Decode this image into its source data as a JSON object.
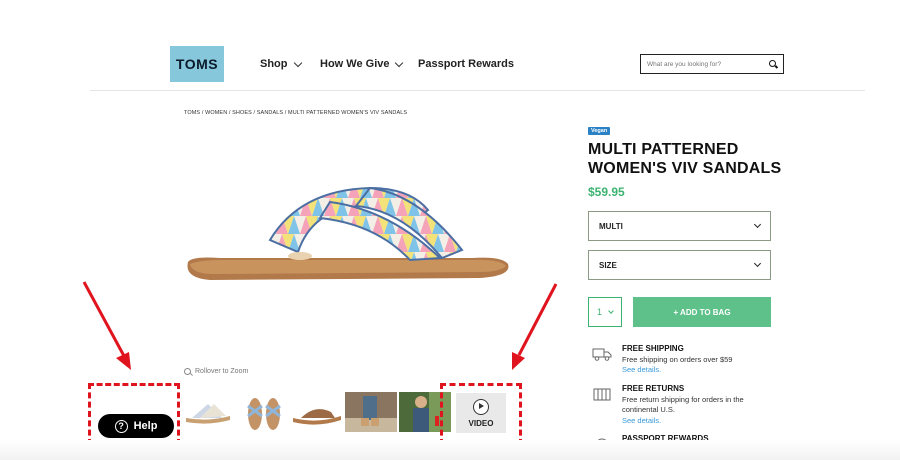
{
  "header": {
    "logo_text": "TOMS",
    "nav": [
      "Shop",
      "How We Give",
      "Passport Rewards"
    ],
    "search_placeholder": "What are you looking for?"
  },
  "breadcrumb": "TOMS / WOMEN / SHOES / SANDALS / MULTI PATTERNED WOMEN'S VIV SANDALS",
  "product": {
    "badge": "Vegan",
    "title": "MULTI PATTERNED WOMEN'S VIV SANDALS",
    "price": "$59.95",
    "color_select": "MULTI",
    "size_select": "SIZE",
    "quantity": "1",
    "add_to_bag": "+ ADD TO BAG",
    "zoom_hint": "Rollover to Zoom",
    "video_label": "VIDEO"
  },
  "info": [
    {
      "icon": "truck-icon",
      "heading": "FREE SHIPPING",
      "text": "Free shipping on orders over $59",
      "link": "See details."
    },
    {
      "icon": "box-return-icon",
      "heading": "FREE RETURNS",
      "text": "Free return shipping for orders in the continental U.S.",
      "link": "See details."
    },
    {
      "icon": "globe-icon",
      "heading": "PASSPORT REWARDS",
      "text": "",
      "link": ""
    }
  ],
  "help_label": "Help",
  "colors": {
    "accent_green": "#5fc18a",
    "price_green": "#3cb371",
    "annotation_red": "#e0141e",
    "logo_blue": "#86c7db",
    "badge_blue": "#2a82c4"
  }
}
